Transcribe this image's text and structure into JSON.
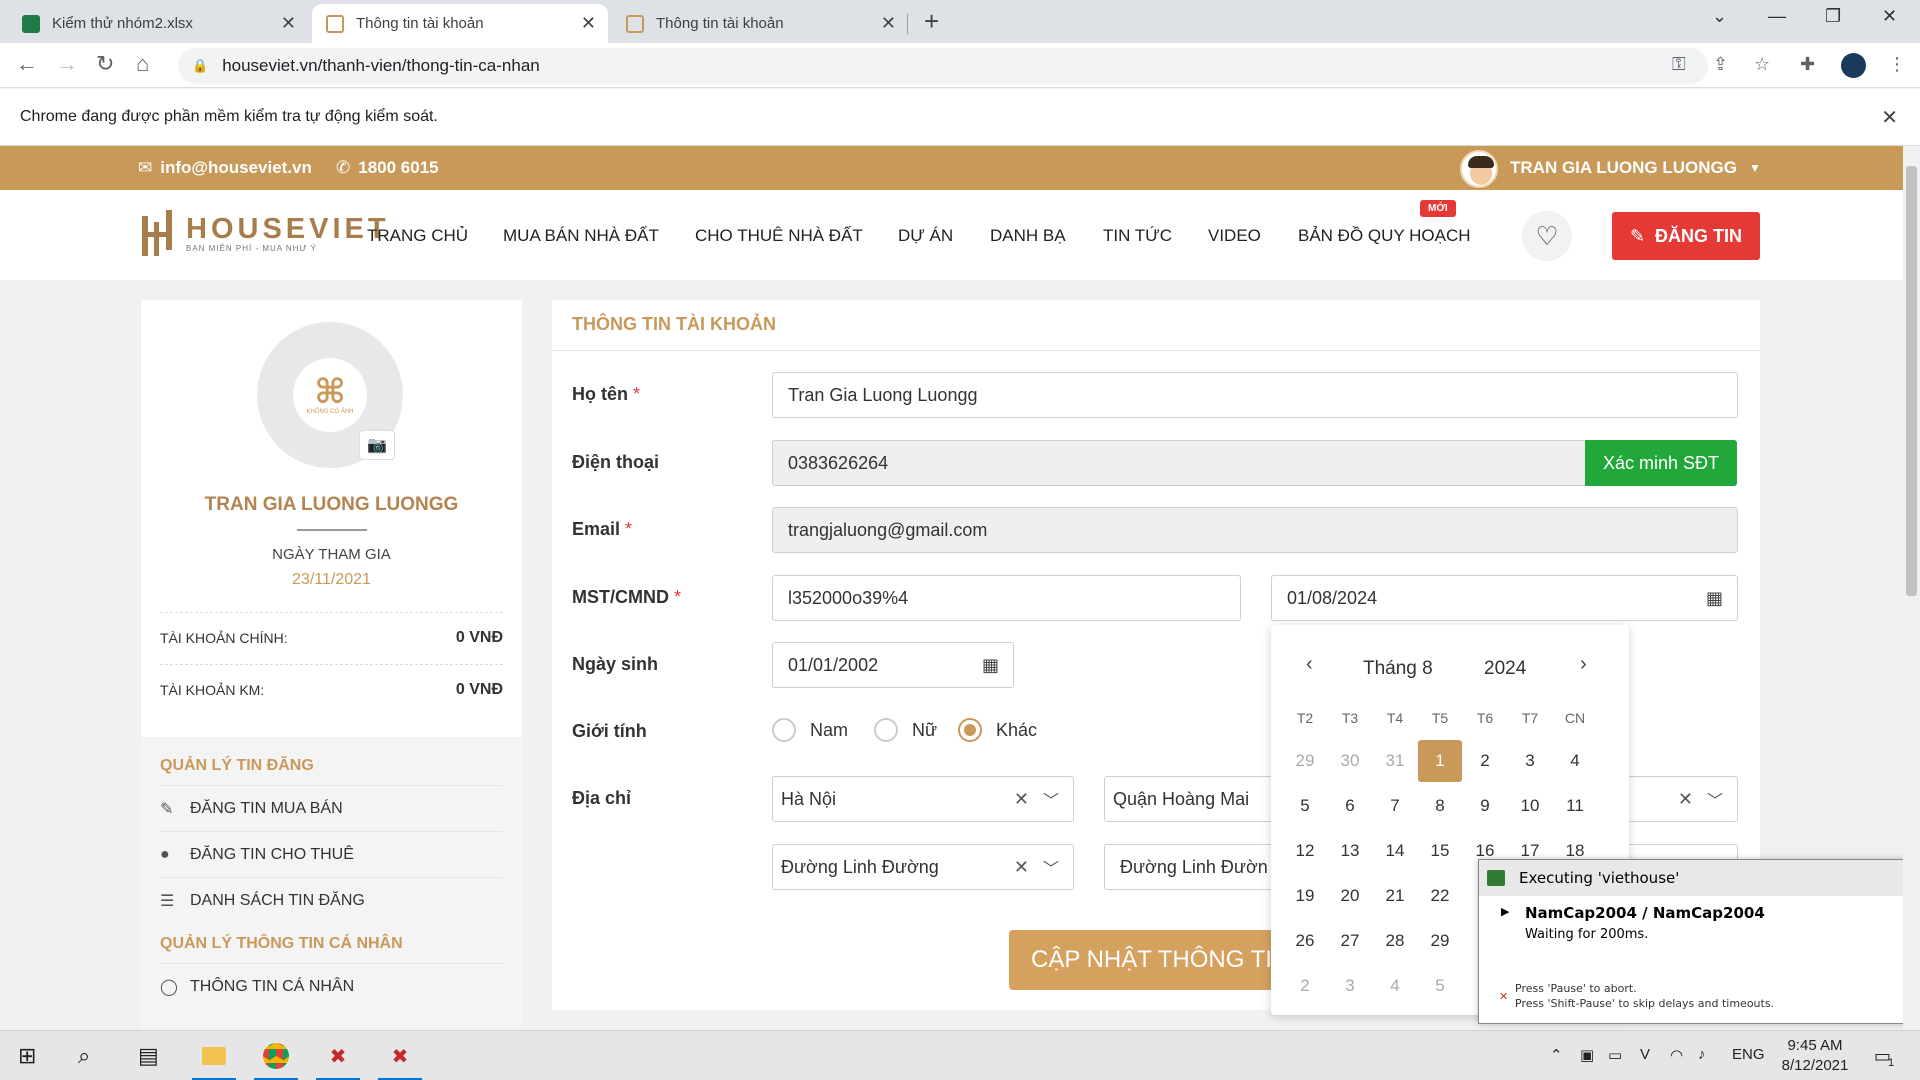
{
  "browser": {
    "tabs": [
      {
        "label": "Kiểm thử nhóm2.xlsx"
      },
      {
        "label": "Thông tin tài khoản"
      },
      {
        "label": "Thông tin tài khoản"
      }
    ],
    "url": "houseviet.vn/thanh-vien/thong-tin-ca-nhan",
    "infobar": "Chrome đang được phần mềm kiểm tra tự động kiểm soát."
  },
  "topbar": {
    "email": "info@houseviet.vn",
    "phone": "1800 6015",
    "user": "TRAN GIA LUONG LUONGG"
  },
  "header": {
    "logo_text": "HOUSEVIET",
    "logo_tagline": "BẠN MIỄN PHÍ - MUA NHƯ Ý",
    "menu": [
      "TRANG CHỦ",
      "MUA BÁN NHÀ ĐẤT",
      "CHO THUÊ NHÀ ĐẤT",
      "DỰ ÁN",
      "DANH BẠ",
      "TIN TỨC",
      "VIDEO",
      "BẢN ĐỒ QUY HOẠCH"
    ],
    "badge_new": "MỚI",
    "post_button": "ĐĂNG TIN"
  },
  "sidebar": {
    "avatar_text": "KHÔNG CÓ ẢNH",
    "name": "TRAN GIA LUONG LUONGG",
    "join_label": "NGÀY THAM GIA",
    "join_date": "23/11/2021",
    "accounts": [
      {
        "label": "TÀI KHOẢN CHÍNH:",
        "value": "0 VNĐ"
      },
      {
        "label": "TÀI KHOẢN KM:",
        "value": "0 VNĐ"
      }
    ],
    "section1_title": "QUẢN LÝ TIN ĐĂNG",
    "section1_items": [
      "ĐĂNG TIN MUA BÁN",
      "ĐĂNG TIN CHO THUÊ",
      "DANH SÁCH TIN ĐĂNG"
    ],
    "section2_title": "QUẢN LÝ THÔNG TIN CÁ NHÂN",
    "section2_items": [
      "THÔNG TIN CÁ NHÂN"
    ]
  },
  "form": {
    "title": "THÔNG TIN TÀI KHOẢN",
    "fullname_label": "Họ tên",
    "fullname": "Tran Gia Luong Luongg",
    "phone_label": "Điện thoại",
    "phone": "0383626264",
    "verify_button": "Xác minh SĐT",
    "email_label": "Email",
    "email": "trangjaluong@gmail.com",
    "id_label": "MST/CMND",
    "id_value": "l352000o39%4",
    "id_date": "01/08/2024",
    "dob_label": "Ngày sinh",
    "dob": "01/01/2002",
    "gender_label": "Giới tính",
    "genders": [
      "Nam",
      "Nữ",
      "Khác"
    ],
    "gender_selected": "Khác",
    "address_label": "Địa chỉ",
    "city": "Hà Nội",
    "district": "Quận Hoàng Mai",
    "street": "Đường Linh Đường",
    "street2": "Đường Linh Đườn",
    "update_button": "CẬP NHẬT THÔNG TIN"
  },
  "datepicker": {
    "month": "Tháng 8",
    "year": "2024",
    "weekdays": [
      "T2",
      "T3",
      "T4",
      "T5",
      "T6",
      "T7",
      "CN"
    ],
    "rows": [
      [
        "29",
        "30",
        "31",
        "1",
        "2",
        "3",
        "4"
      ],
      [
        "5",
        "6",
        "7",
        "8",
        "9",
        "10",
        "11"
      ],
      [
        "12",
        "13",
        "14",
        "15",
        "16",
        "17",
        "18"
      ],
      [
        "19",
        "20",
        "21",
        "22"
      ],
      [
        "26",
        "27",
        "28",
        "29"
      ],
      [
        "2",
        "3",
        "4",
        "5"
      ]
    ],
    "selected": "1"
  },
  "ranorex": {
    "title": "Executing 'viethouse'",
    "item": "NamCap2004 / NamCap2004",
    "status": "Waiting for 200ms.",
    "hint1": "Press 'Pause' to abort.",
    "hint2": "Press 'Shift-Pause' to skip delays and timeouts."
  },
  "taskbar": {
    "lang": "ENG",
    "time": "9:45 AM",
    "date": "8/12/2021",
    "notif_count": "1"
  },
  "colors": {
    "brand": "#c9995a",
    "danger": "#e53935",
    "success": "#22a83a"
  }
}
